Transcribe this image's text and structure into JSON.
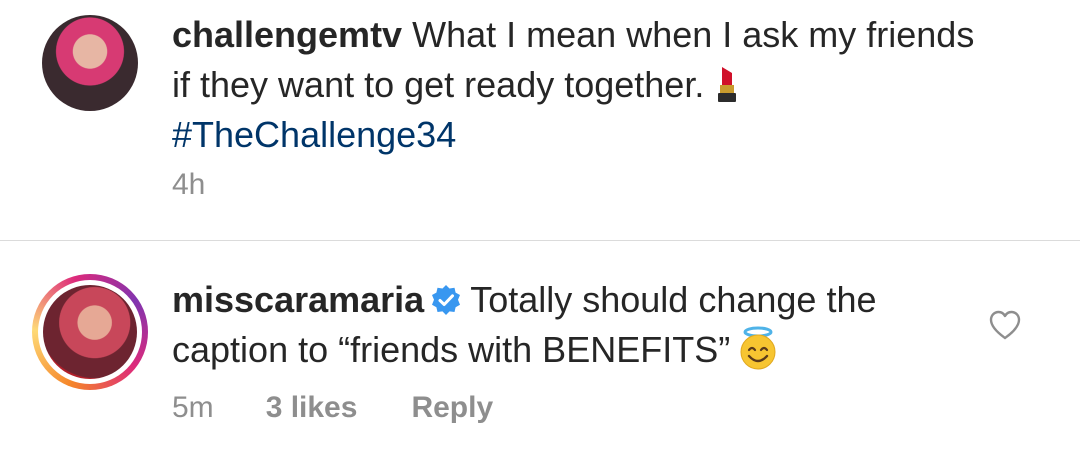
{
  "caption": {
    "username": "challengemtv",
    "text": "What I mean when I ask my friends if they want to get ready together.",
    "emoji_icon": "lipstick-icon",
    "hashtag": "#TheChallenge34",
    "time": "4h"
  },
  "comment": {
    "username": "misscaramaria",
    "verified": true,
    "text": "Totally should change the caption to “friends with BENEFITS”",
    "emoji_icon": "smiling-face-with-halo-icon",
    "time": "5m",
    "likes": "3 likes",
    "reply_label": "Reply",
    "like_icon": "heart-outline-icon"
  },
  "colors": {
    "text": "#262626",
    "secondary": "#8e8e8e",
    "hashtag": "#003569",
    "verified": "#3897f0",
    "divider": "#dbdbdb"
  }
}
